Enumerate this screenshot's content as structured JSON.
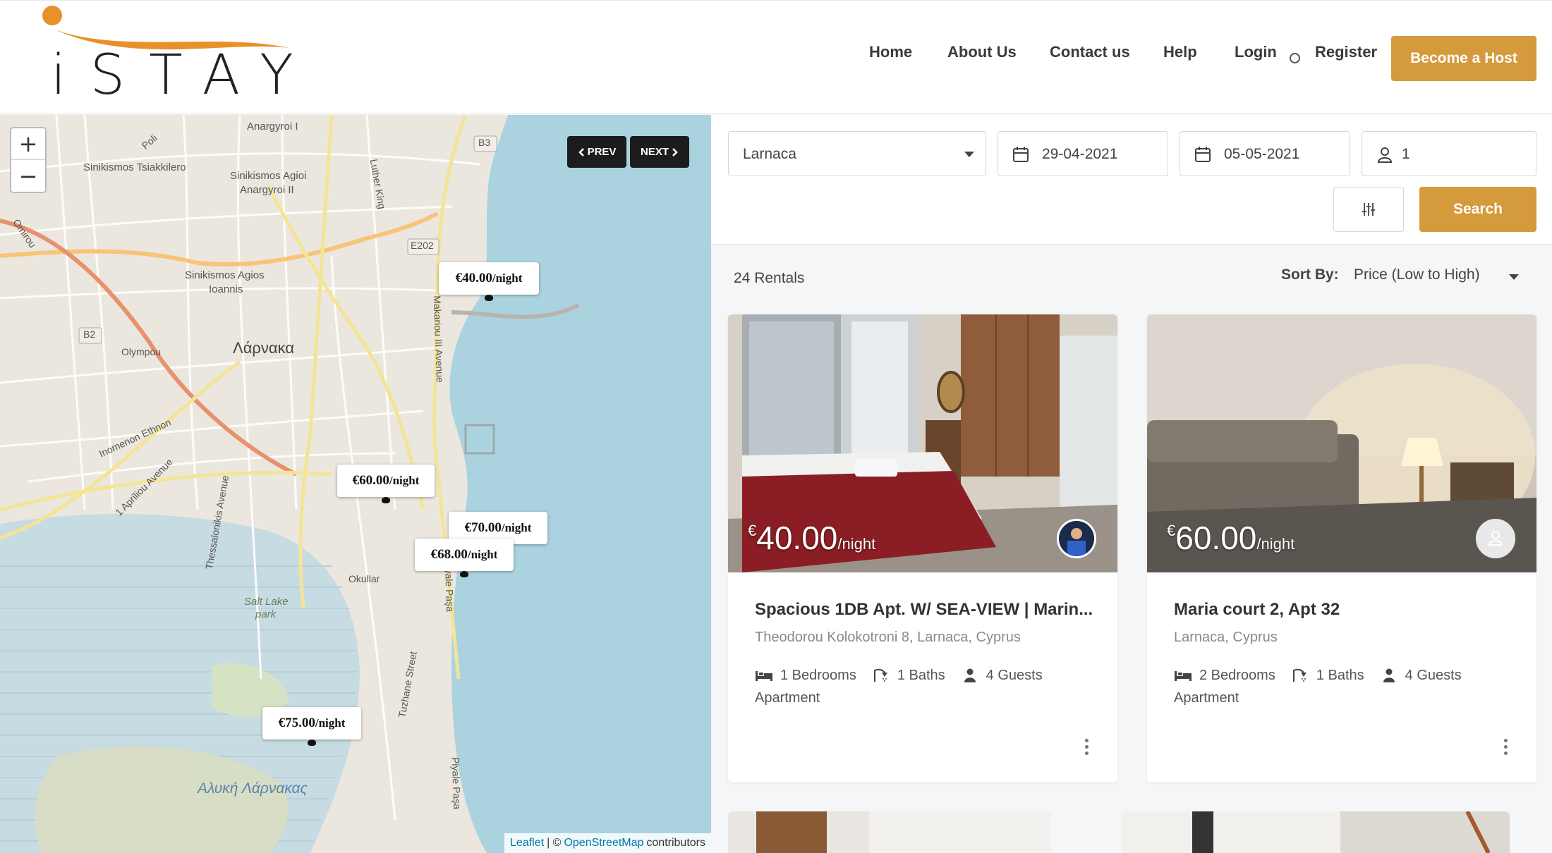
{
  "brand": {
    "name": "iSTAY",
    "logo_letters": "iSTAY",
    "accent_color": "#d59a3b",
    "swoosh_color": "#e8912b"
  },
  "nav": {
    "home": "Home",
    "about": "About Us",
    "contact": "Contact us",
    "help": "Help",
    "login": "Login",
    "register": "Register",
    "become_host": "Become a Host"
  },
  "map": {
    "zoom_in": "+",
    "zoom_out": "−",
    "prev_label": "PREV",
    "next_label": "NEXT",
    "markers": [
      {
        "price": "€40.00",
        "unit": "/night"
      },
      {
        "price": "€60.00",
        "unit": "/night"
      },
      {
        "price": "€70.00",
        "unit": "/night"
      },
      {
        "price": "€68.00",
        "unit": "/night"
      },
      {
        "price": "€75.00",
        "unit": "/night"
      }
    ],
    "labels": {
      "anargyroi1": "Anargyroi I",
      "tsiakkilero": "Sinikismos Tsiakkilero",
      "agioi_anargyroi": "Sinikismos Agioi",
      "agioi_anargyroi2": "Anargyroi II",
      "agios_ioannis": "Sinikismos Agios",
      "agios_ioannis2": "Ioannis",
      "larnaka": "Λάρνακα",
      "olympou": "Olympou",
      "inomenon": "Inomenon Ethnon",
      "apriliou": "1 Apriliou Avenue",
      "thessalonikis": "Thessalonikis Avenue",
      "salt_lake": "Salt Lake",
      "salt_lake2": "park",
      "okullar": "Okullar",
      "alyki": "Αλυκή Λάρνακας",
      "b3": "B3",
      "b2": "B2",
      "e202": "E202",
      "luther": "Luther King",
      "makariou": "Makariou III Avenue",
      "piyale": "Piyale Paşa",
      "piyale2": "Piyale Paşa",
      "tuzhane": "Tuzhane Street",
      "poli": "Poli",
      "omirou": "Omirou"
    },
    "attribution": {
      "leaflet": "Leaflet",
      "sep": "| ©",
      "osm": "OpenStreetMap",
      "contributors": "contributors"
    }
  },
  "search": {
    "location": "Larnaca",
    "checkin": "29-04-2021",
    "checkout": "05-05-2021",
    "guests": "1",
    "search_label": "Search"
  },
  "results": {
    "count": "24 Rentals",
    "sort_label": "Sort By:",
    "sort_value": "Price (Low to High)"
  },
  "cards": [
    {
      "currency": "€",
      "amount": "40.00",
      "per": "/night",
      "title": "Spacious 1DB Apt. W/ SEA-VIEW | Marin...",
      "address": "Theodorou Kolokotroni 8, Larnaca, Cyprus",
      "bedrooms": "1 Bedrooms",
      "baths": "1 Baths",
      "guests": "4 Guests",
      "type": "Apartment"
    },
    {
      "currency": "€",
      "amount": "60.00",
      "per": "/night",
      "title": "Maria court 2, Apt 32",
      "address": "Larnaca, Cyprus",
      "bedrooms": "2 Bedrooms",
      "baths": "1 Baths",
      "guests": "4 Guests",
      "type": "Apartment"
    }
  ]
}
